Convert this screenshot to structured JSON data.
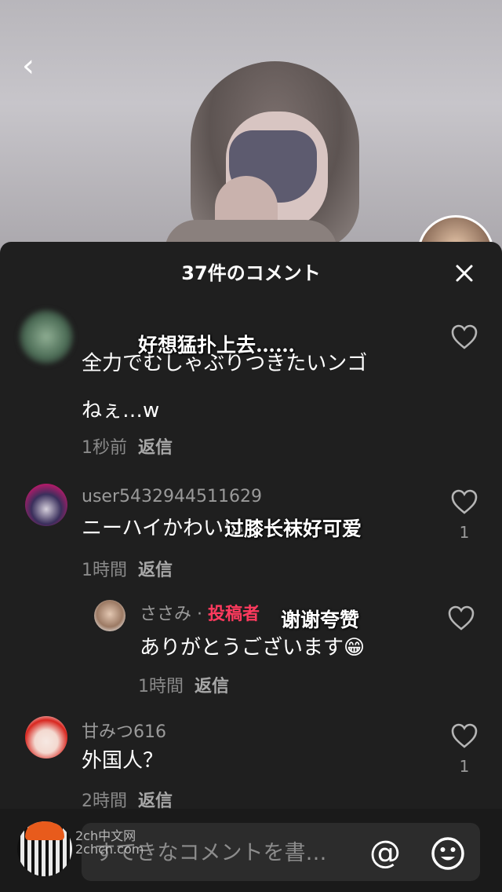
{
  "header": {
    "title": "37件のコメント"
  },
  "comments": [
    {
      "username": "",
      "text_line1": "全力でむしゃぶりつきたいンゴ",
      "text_line2": "ねぇ…w",
      "time": "1秒前",
      "reply_label": "返信",
      "like_count": "",
      "overlay_caption": "好想猛扑上去……"
    },
    {
      "username": "user5432944511629",
      "text": "ニーハイかわいい",
      "time": "1時間",
      "reply_label": "返信",
      "like_count": "1",
      "overlay_caption": "过膝长袜好可爱"
    },
    {
      "username": "甘みつ616",
      "text": "外国人？",
      "time": "2時間",
      "reply_label": "返信",
      "like_count": "1"
    }
  ],
  "reply": {
    "username": "ささみ",
    "separator": "·",
    "author_tag": "投稿者",
    "text": "ありがとうございます😁",
    "time": "1時間",
    "reply_label": "返信",
    "overlay_caption": "谢谢夸赞"
  },
  "composer": {
    "placeholder": "すてきなコメントを書…",
    "mention_symbol": "@"
  },
  "watermark": {
    "line1": "2ch中文网",
    "line2": "2chcn.com"
  },
  "colors": {
    "author_tag": "#ff3a5e",
    "sheet_bg": "#1f1f1f"
  },
  "icons": [
    "back-icon",
    "close-icon",
    "heart-icon",
    "mention-icon",
    "emoji-icon"
  ]
}
